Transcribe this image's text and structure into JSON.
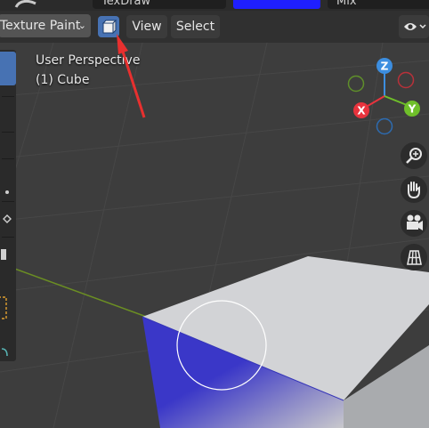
{
  "top_strip": {
    "brush_name": "TexDraw",
    "brush_color": "#1f1fff",
    "blend_mode": "Mix"
  },
  "header": {
    "mode": "Texture Paint",
    "menus": {
      "view": "View",
      "select": "Select"
    }
  },
  "viewport": {
    "perspective_label": "User Perspective",
    "object_label": "(1) Cube"
  },
  "gizmo": {
    "axes": {
      "z": "Z",
      "x": "X",
      "y": "Y"
    }
  },
  "colors": {
    "accent": "#4772b3",
    "x_axis": "#e8333d",
    "y_axis": "#6fbf2a",
    "z_axis": "#3c8ee0",
    "paint": "#3a37c8"
  }
}
